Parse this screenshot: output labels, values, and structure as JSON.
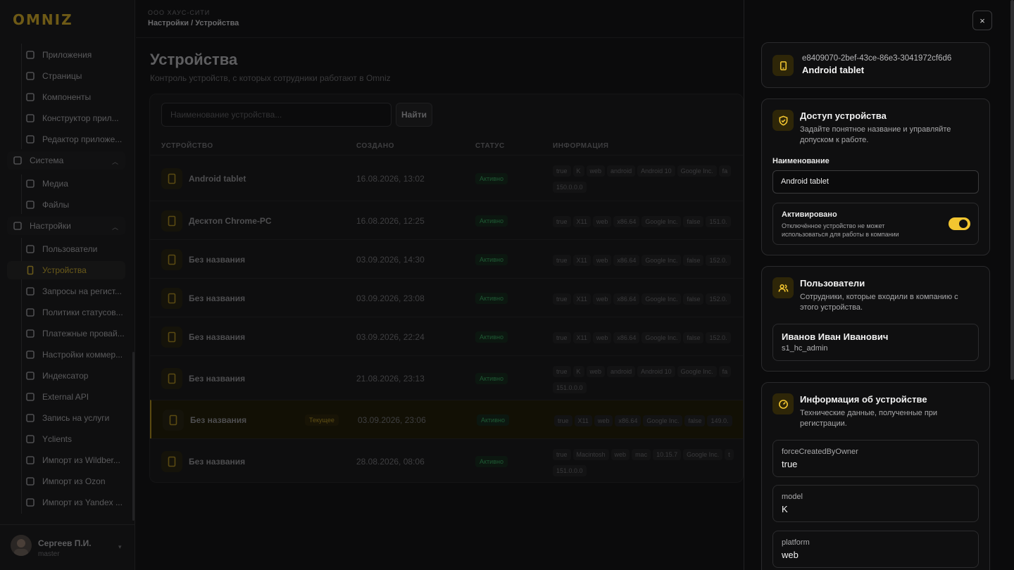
{
  "brand": {
    "logo_text": "OMNIZ",
    "accent": "#f2c530"
  },
  "sidebar": {
    "items": [
      {
        "label": "Приложения",
        "icon": "puzzle-icon"
      },
      {
        "label": "Страницы",
        "icon": "pages-icon"
      },
      {
        "label": "Компоненты",
        "icon": "components-icon"
      },
      {
        "label": "Конструктор прил...",
        "icon": "wand-icon"
      },
      {
        "label": "Редактор приложе...",
        "icon": "edit-icon"
      }
    ],
    "system_group": {
      "label": "Система",
      "icon": "cube-icon"
    },
    "system_items": [
      {
        "label": "Медиа",
        "icon": "media-icon"
      },
      {
        "label": "Файлы",
        "icon": "files-icon"
      }
    ],
    "settings_group": {
      "label": "Настройки",
      "icon": "gear-icon"
    },
    "settings_items": [
      {
        "label": "Пользователи",
        "icon": "users-icon"
      },
      {
        "label": "Устройства",
        "icon": "tablet-icon",
        "active": true
      },
      {
        "label": "Запросы на регист...",
        "icon": "user-request-icon"
      },
      {
        "label": "Политики статусов...",
        "icon": "shield-icon"
      },
      {
        "label": "Платежные провай...",
        "icon": "archive-icon"
      },
      {
        "label": "Настройки коммер...",
        "icon": "wrench-icon"
      },
      {
        "label": "Индексатор",
        "icon": "refresh-icon"
      },
      {
        "label": "External API",
        "icon": "key-icon"
      },
      {
        "label": "Запись на услуги",
        "icon": "clock-icon"
      },
      {
        "label": "Yclients",
        "icon": "yclients-icon"
      },
      {
        "label": "Импорт из Wildber...",
        "icon": "cloud-import-icon"
      },
      {
        "label": "Импорт из Ozon",
        "icon": "cloud-import-icon"
      },
      {
        "label": "Импорт из Yandex ...",
        "icon": "cloud-import-icon"
      }
    ],
    "user": {
      "name": "Сергеев П.И.",
      "role": "master"
    }
  },
  "header": {
    "org": "ООО ХАУС-СИТИ",
    "breadcrumb": "Настройки / Устройства"
  },
  "page": {
    "title": "Устройства",
    "subtitle": "Контроль устройств, с которых сотрудники работают в Omniz",
    "search_placeholder": "Наименование устройства...",
    "find_label": "Найти",
    "columns": {
      "device": "УСТРОЙСТВО",
      "created": "СОЗДАНО",
      "status": "СТАТУС",
      "info": "ИНФОРМАЦИЯ"
    },
    "current_badge": "Текущее",
    "rows": [
      {
        "name": "Android tablet",
        "created": "16.08.2026, 13:02",
        "status": "Активно",
        "tags": [
          "true",
          "K",
          "web",
          "android",
          "Android 10",
          "Google Inc.",
          "fa",
          "150.0.0.0"
        ]
      },
      {
        "name": "Десктоп Chrome-PC",
        "created": "16.08.2026, 12:25",
        "status": "Активно",
        "tags": [
          "true",
          "X11",
          "web",
          "x86.64",
          "Google Inc.",
          "false",
          "151.0."
        ]
      },
      {
        "name": "Без названия",
        "created": "03.09.2026, 14:30",
        "status": "Активно",
        "tags": [
          "true",
          "X11",
          "web",
          "x86.64",
          "Google Inc.",
          "false",
          "152.0."
        ]
      },
      {
        "name": "Без названия",
        "created": "03.09.2026, 23:08",
        "status": "Активно",
        "tags": [
          "true",
          "X11",
          "web",
          "x86.64",
          "Google Inc.",
          "false",
          "152.0."
        ]
      },
      {
        "name": "Без названия",
        "created": "03.09.2026, 22:24",
        "status": "Активно",
        "tags": [
          "true",
          "X11",
          "web",
          "x86.64",
          "Google Inc.",
          "false",
          "152.0."
        ]
      },
      {
        "name": "Без названия",
        "created": "21.08.2026, 23:13",
        "status": "Активно",
        "tags": [
          "true",
          "K",
          "web",
          "android",
          "Android 10",
          "Google Inc.",
          "fa",
          "151.0.0.0"
        ]
      },
      {
        "name": "Без названия",
        "created": "03.09.2026, 23:06",
        "status": "Активно",
        "current": true,
        "tags": [
          "true",
          "X11",
          "web",
          "x86.64",
          "Google Inc.",
          "false",
          "149.0."
        ]
      },
      {
        "name": "Без названия",
        "created": "28.08.2026, 08:06",
        "status": "Активно",
        "tags": [
          "true",
          "Macintosh",
          "web",
          "mac",
          "10.15.7",
          "Google Inc.",
          "t",
          "151.0.0.0"
        ]
      }
    ]
  },
  "drawer": {
    "close_icon": "×",
    "device_id": "e8409070-2bef-43ce-86e3-3041972cf6d6",
    "device_name": "Android tablet",
    "access": {
      "title": "Доступ устройства",
      "desc": "Задайте понятное название и управляйте допуском к работе.",
      "name_label": "Наименование",
      "name_value": "Android tablet",
      "enabled_title": "Активировано",
      "enabled_desc": "Отключённое устройство не может использоваться для работы в компании",
      "enabled": true
    },
    "users": {
      "title": "Пользователи",
      "desc": "Сотрудники, которые входили в компанию с этого устройства.",
      "list": [
        {
          "name": "Иванов Иван Иванович",
          "login": "s1_hc_admin"
        }
      ]
    },
    "info": {
      "title": "Информация об устройстве",
      "desc": "Технические данные, полученные при регистрации.",
      "fields": [
        {
          "key": "forceCreatedByOwner",
          "value": "true"
        },
        {
          "key": "model",
          "value": "K"
        },
        {
          "key": "platform",
          "value": "web"
        }
      ]
    }
  }
}
